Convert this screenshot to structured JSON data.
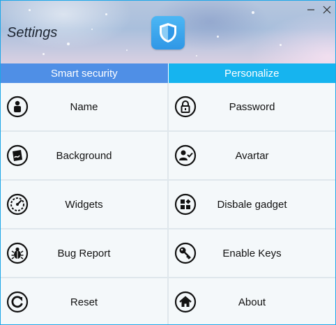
{
  "window": {
    "title": "Settings",
    "controls": {
      "minimize_icon": "minimize-icon",
      "close_icon": "close-icon"
    }
  },
  "tabs": [
    {
      "label": "Smart security",
      "color": "#4f8fe6"
    },
    {
      "label": "Personalize",
      "color": "#16b4ef"
    }
  ],
  "items": [
    {
      "label": "Name",
      "icon": "user-icon"
    },
    {
      "label": "Password",
      "icon": "lock-icon"
    },
    {
      "label": "Background",
      "icon": "wallpaper-icon"
    },
    {
      "label": "Avartar",
      "icon": "user-check-icon"
    },
    {
      "label": "Widgets",
      "icon": "gauge-icon"
    },
    {
      "label": "Disbale gadget",
      "icon": "widgets-grid-icon"
    },
    {
      "label": "Bug Report",
      "icon": "bug-icon"
    },
    {
      "label": "Enable Keys",
      "icon": "key-icon"
    },
    {
      "label": "Reset",
      "icon": "reset-icon"
    },
    {
      "label": "About",
      "icon": "home-icon"
    }
  ]
}
